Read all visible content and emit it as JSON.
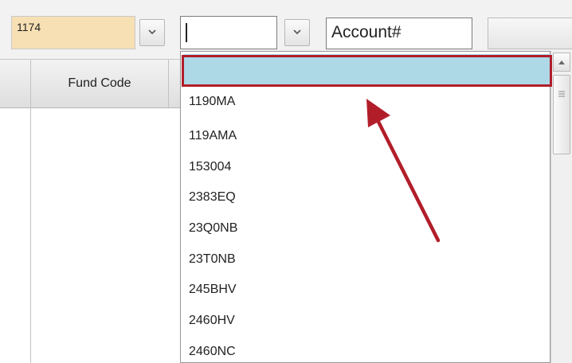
{
  "toolbar": {
    "code_value": "1174",
    "filter_value": "",
    "account_placeholder": "Account#"
  },
  "grid": {
    "columns": [
      "Fund Code"
    ]
  },
  "dropdown": {
    "items": [
      "",
      "1190MA",
      "119AMA",
      "153004",
      "2383EQ",
      "23Q0NB",
      "23T0NB",
      "245BHV",
      "2460HV",
      "2460NC"
    ]
  },
  "icons": {
    "dropdown_button": "chevron-down-icon",
    "scroll_up": "arrow-up-icon",
    "scroll_grip": "grip-icon",
    "annotation": "arrow-icon"
  },
  "colors": {
    "annotation_red": "#b11e2a",
    "selected_item": "#add8e6",
    "code_field_bg": "#f8e0b5"
  }
}
